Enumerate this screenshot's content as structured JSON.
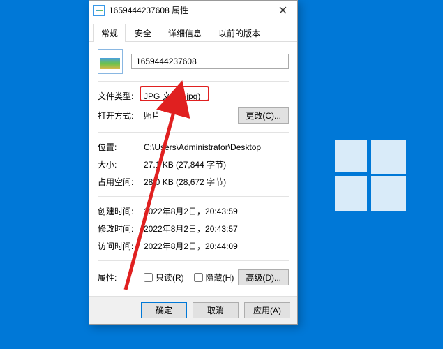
{
  "titlebar": {
    "title": "1659444237608 属性"
  },
  "tabs": {
    "general": "常规",
    "security": "安全",
    "details": "详细信息",
    "previous": "以前的版本"
  },
  "filename": "1659444237608",
  "fields": {
    "fileTypeLabel": "文件类型:",
    "fileTypeValue": "JPG 文件 (.jpg)",
    "opensWithLabel": "打开方式:",
    "opensWithValue": "照片",
    "changeBtn": "更改(C)...",
    "locationLabel": "位置:",
    "locationValue": "C:\\Users\\Administrator\\Desktop",
    "sizeLabel": "大小:",
    "sizeValue": "27.1 KB (27,844 字节)",
    "sizeOnDiskLabel": "占用空间:",
    "sizeOnDiskValue": "28.0 KB (28,672 字节)",
    "createdLabel": "创建时间:",
    "createdValue": "2022年8月2日，20:43:59",
    "modifiedLabel": "修改时间:",
    "modifiedValue": "2022年8月2日，20:43:57",
    "accessedLabel": "访问时间:",
    "accessedValue": "2022年8月2日，20:44:09",
    "attrLabel": "属性:",
    "readonly": "只读(R)",
    "hidden": "隐藏(H)",
    "advancedBtn": "高级(D)..."
  },
  "footer": {
    "ok": "确定",
    "cancel": "取消",
    "apply": "应用(A)"
  }
}
